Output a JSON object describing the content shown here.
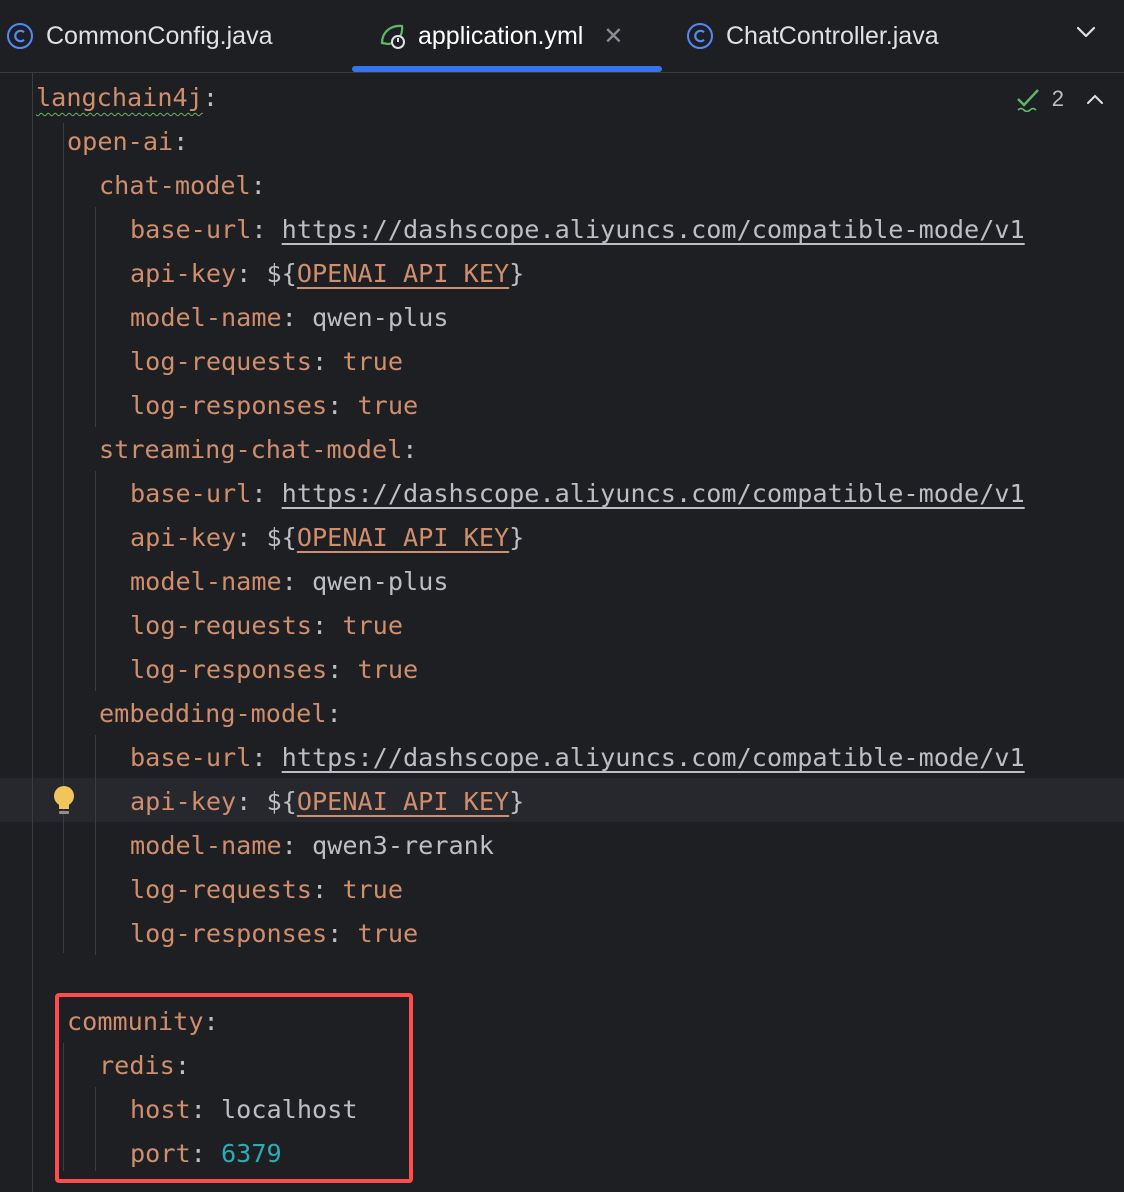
{
  "tabs": [
    {
      "label": "CommonConfig.java",
      "icon": "java-class-icon",
      "active": false
    },
    {
      "label": "application.yml",
      "icon": "spring-yaml-icon",
      "active": true
    },
    {
      "label": "ChatController.java",
      "icon": "java-class-icon",
      "active": false
    }
  ],
  "inspection": {
    "count": "2",
    "icon": "double-check-icon"
  },
  "colors": {
    "background": "#1e1f22",
    "key": "#cf8e6d",
    "text": "#bcbec4",
    "number": "#2aacb8",
    "active_tab_underline": "#3574f0",
    "highlight_box": "#ff4d4f"
  },
  "code": {
    "l1": {
      "key": "langchain4j"
    },
    "l2": {
      "key": "open-ai"
    },
    "l3": {
      "key": "chat-model"
    },
    "l4": {
      "key": "base-url",
      "value": "https://dashscope.aliyuncs.com/compatible-mode/v1"
    },
    "l5": {
      "key": "api-key",
      "prefix": "${",
      "env": "OPENAI_API_KEY",
      "suffix": "}"
    },
    "l6": {
      "key": "model-name",
      "value": "qwen-plus"
    },
    "l7": {
      "key": "log-requests",
      "value": "true"
    },
    "l8": {
      "key": "log-responses",
      "value": "true"
    },
    "l9": {
      "key": "streaming-chat-model"
    },
    "l10": {
      "key": "base-url",
      "value": "https://dashscope.aliyuncs.com/compatible-mode/v1"
    },
    "l11": {
      "key": "api-key",
      "prefix": "${",
      "env": "OPENAI_API_KEY",
      "suffix": "}"
    },
    "l12": {
      "key": "model-name",
      "value": "qwen-plus"
    },
    "l13": {
      "key": "log-requests",
      "value": "true"
    },
    "l14": {
      "key": "log-responses",
      "value": "true"
    },
    "l15": {
      "key": "embedding-model"
    },
    "l16": {
      "key": "base-url",
      "value": "https://dashscope.aliyuncs.com/compatible-mode/v1"
    },
    "l17": {
      "key": "api-key",
      "prefix": "${",
      "env": "OPENAI_API_KEY",
      "suffix": "}"
    },
    "l18": {
      "key": "model-name",
      "value": "qwen3-rerank"
    },
    "l19": {
      "key": "log-requests",
      "value": "true"
    },
    "l20": {
      "key": "log-responses",
      "value": "true"
    },
    "l22": {
      "key": "community"
    },
    "l23": {
      "key": "redis"
    },
    "l24": {
      "key": "host",
      "value": "localhost"
    },
    "l25": {
      "key": "port",
      "value": "6379"
    }
  }
}
